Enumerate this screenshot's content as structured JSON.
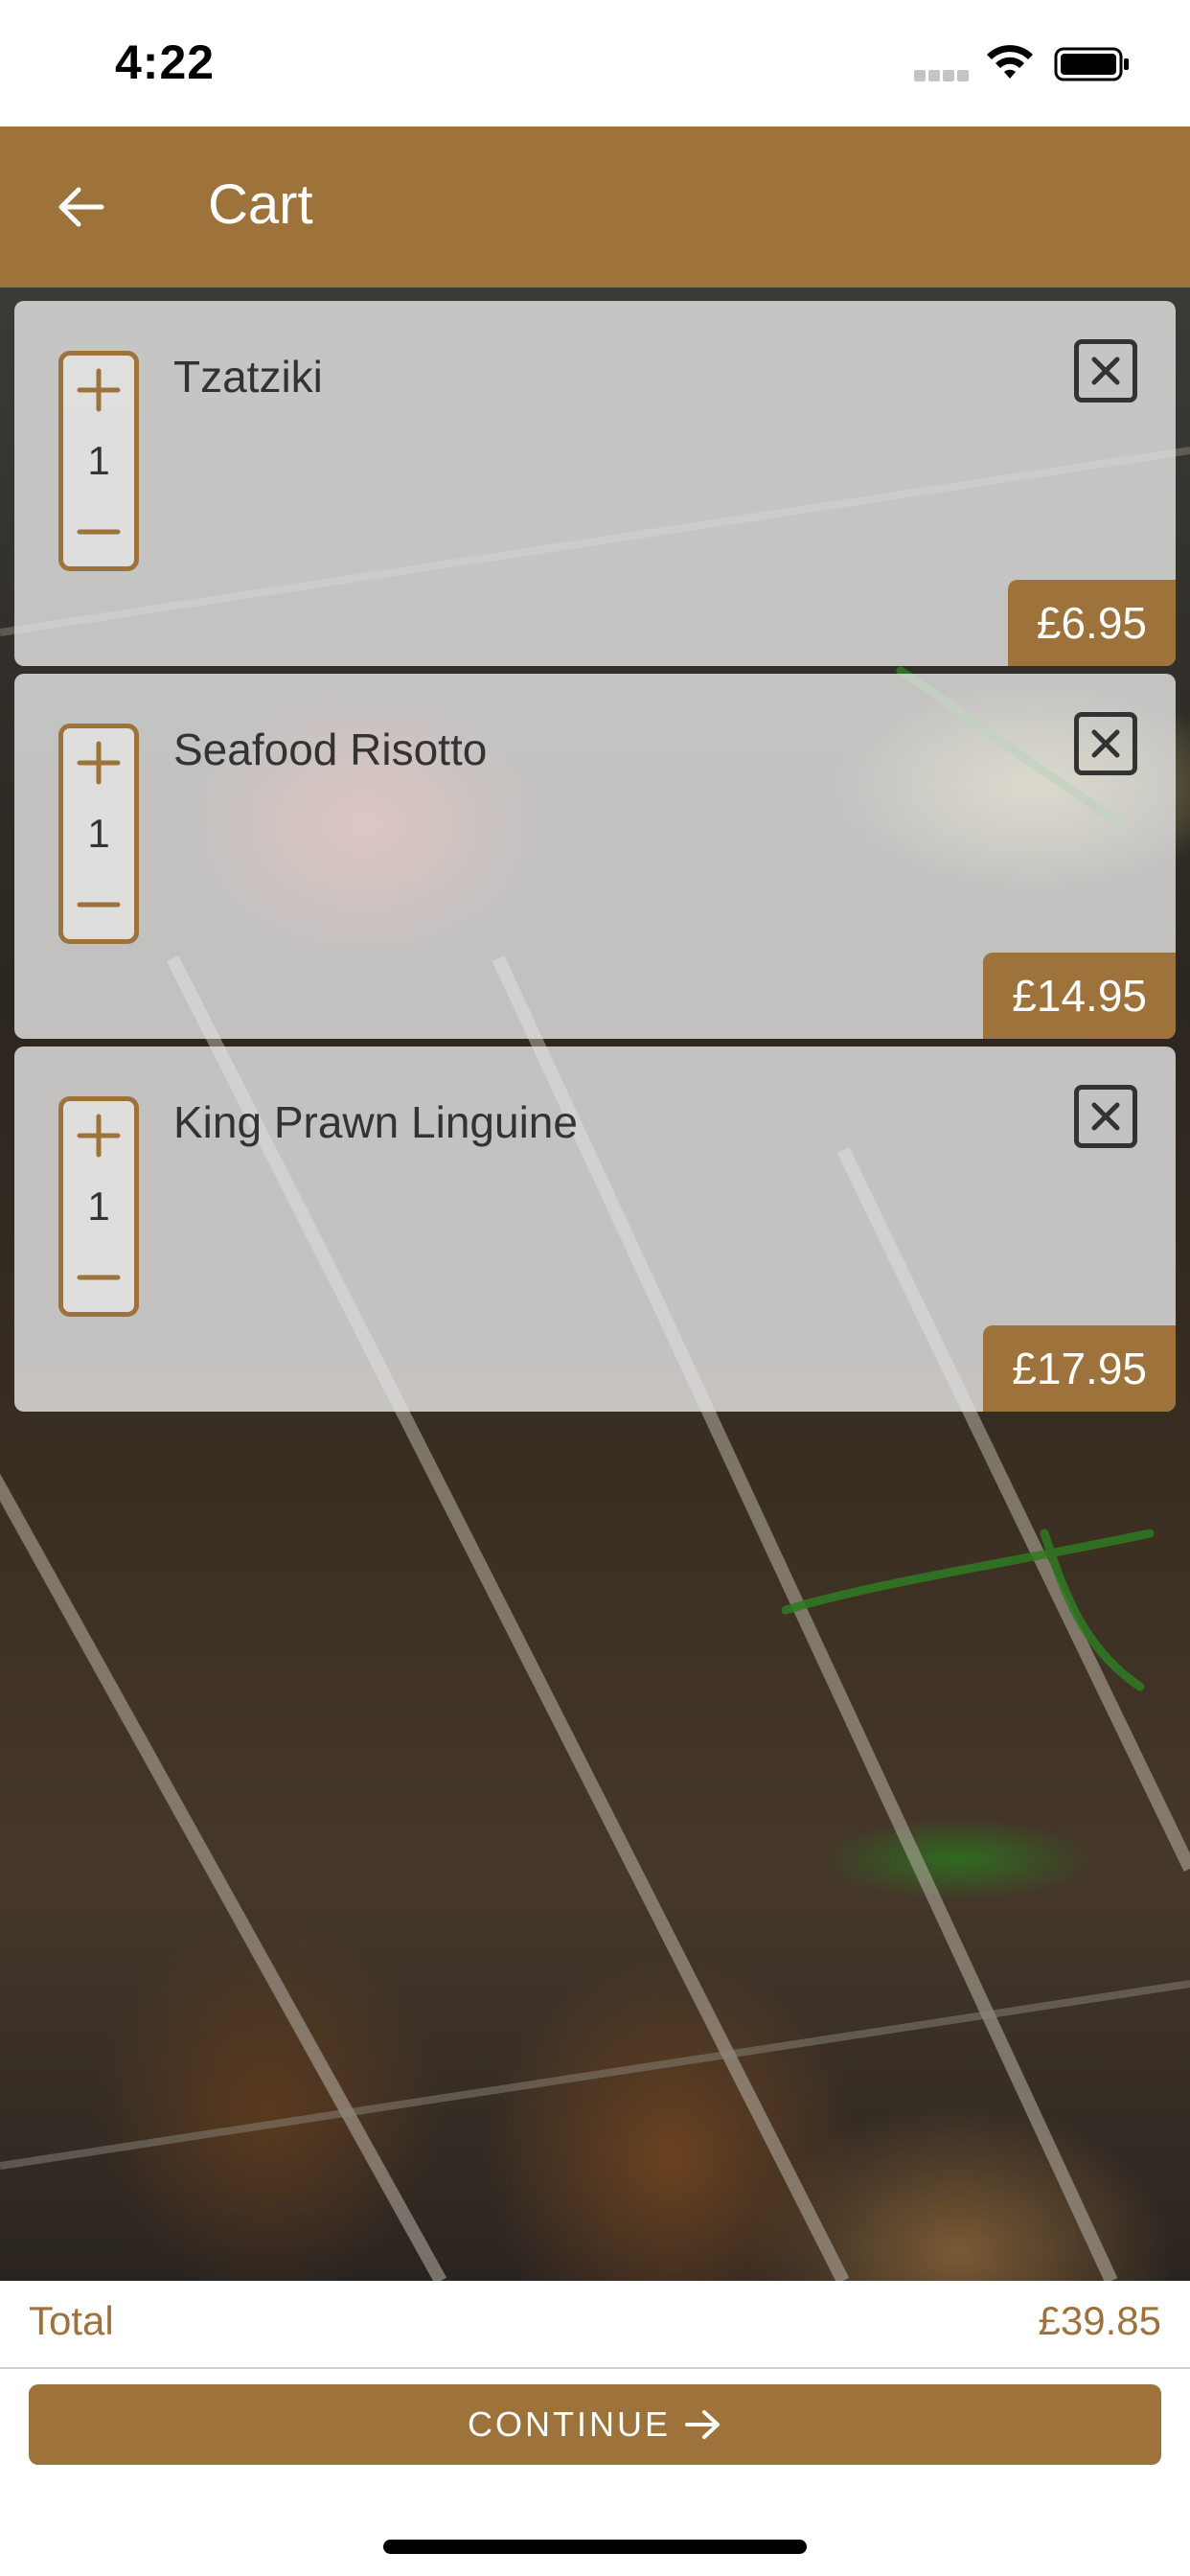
{
  "status_bar": {
    "time": "4:22"
  },
  "header": {
    "title": "Cart",
    "back_icon": "arrow-left-icon",
    "background_color": "#9d733b"
  },
  "cart": {
    "items": [
      {
        "name": "Tzatziki",
        "quantity": "1",
        "price": "£6.95"
      },
      {
        "name": "Seafood Risotto",
        "quantity": "1",
        "price": "£14.95"
      },
      {
        "name": "King Prawn Linguine",
        "quantity": "1",
        "price": "£17.95"
      }
    ]
  },
  "footer": {
    "total_label": "Total",
    "total_value": "£39.85",
    "continue_label": "CONTINUE",
    "continue_icon": "arrow-right-icon"
  },
  "colors": {
    "accent": "#9d733b",
    "card": "#e8e8e8",
    "text": "#333333"
  }
}
